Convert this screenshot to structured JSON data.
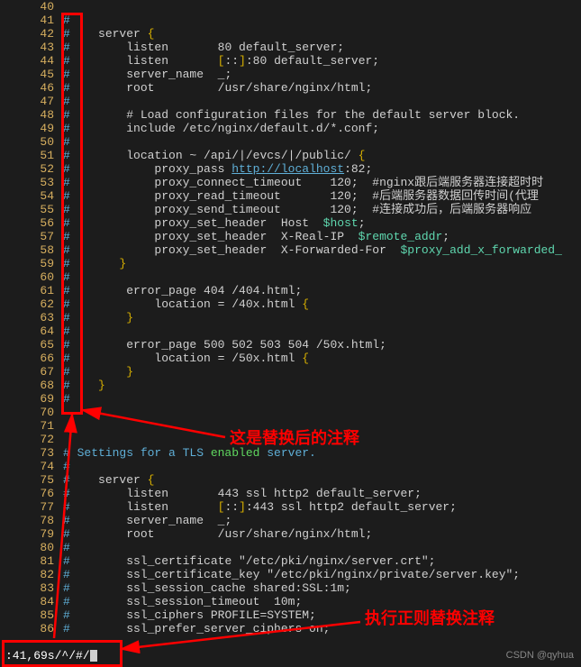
{
  "lines": [
    {
      "n": 40,
      "segs": [
        {
          "t": "",
          "cls": ""
        }
      ]
    },
    {
      "n": 41,
      "segs": [
        {
          "t": "#",
          "cls": "c-comment"
        }
      ]
    },
    {
      "n": 42,
      "segs": [
        {
          "t": "#",
          "cls": "c-comment"
        },
        {
          "t": "    server ",
          "cls": "c-default"
        },
        {
          "t": "{",
          "cls": "c-bracket"
        }
      ]
    },
    {
      "n": 43,
      "segs": [
        {
          "t": "#",
          "cls": "c-comment"
        },
        {
          "t": "        listen       80 default_server;",
          "cls": "c-default"
        }
      ]
    },
    {
      "n": 44,
      "segs": [
        {
          "t": "#",
          "cls": "c-comment"
        },
        {
          "t": "        listen       ",
          "cls": "c-default"
        },
        {
          "t": "[",
          "cls": "c-bracket"
        },
        {
          "t": "::",
          "cls": "c-default"
        },
        {
          "t": "]",
          "cls": "c-bracket"
        },
        {
          "t": ":80 default_server;",
          "cls": "c-default"
        }
      ]
    },
    {
      "n": 45,
      "segs": [
        {
          "t": "#",
          "cls": "c-comment"
        },
        {
          "t": "        server_name  _;",
          "cls": "c-default"
        }
      ]
    },
    {
      "n": 46,
      "segs": [
        {
          "t": "#",
          "cls": "c-comment"
        },
        {
          "t": "        root         /usr/share/nginx/html;",
          "cls": "c-default"
        }
      ]
    },
    {
      "n": 47,
      "segs": [
        {
          "t": "#",
          "cls": "c-comment"
        }
      ]
    },
    {
      "n": 48,
      "segs": [
        {
          "t": "#",
          "cls": "c-comment"
        },
        {
          "t": "        # Load configuration files for the default server block.",
          "cls": "c-default"
        }
      ]
    },
    {
      "n": 49,
      "segs": [
        {
          "t": "#",
          "cls": "c-comment"
        },
        {
          "t": "        include /etc/nginx/default.d/*.conf;",
          "cls": "c-default"
        }
      ]
    },
    {
      "n": 50,
      "segs": [
        {
          "t": "#",
          "cls": "c-comment"
        }
      ]
    },
    {
      "n": 51,
      "segs": [
        {
          "t": "#",
          "cls": "c-comment"
        },
        {
          "t": "        location ~ /api/|/evcs/|/public/ ",
          "cls": "c-default"
        },
        {
          "t": "{",
          "cls": "c-bracket"
        }
      ]
    },
    {
      "n": 52,
      "segs": [
        {
          "t": "#",
          "cls": "c-comment"
        },
        {
          "t": "            proxy_pass ",
          "cls": "c-default"
        },
        {
          "t": "http://localhost",
          "cls": "c-host"
        },
        {
          "t": ":82;",
          "cls": "c-default"
        }
      ]
    },
    {
      "n": 53,
      "segs": [
        {
          "t": "#",
          "cls": "c-comment"
        },
        {
          "t": "            proxy_connect_timeout    120;  #nginx跟后端服务器连接超时时",
          "cls": "c-default"
        }
      ]
    },
    {
      "n": 54,
      "segs": [
        {
          "t": "#",
          "cls": "c-comment"
        },
        {
          "t": "            proxy_read_timeout       120;  #后端服务器数据回传时间(代理",
          "cls": "c-default"
        }
      ]
    },
    {
      "n": 55,
      "segs": [
        {
          "t": "#",
          "cls": "c-comment"
        },
        {
          "t": "            proxy_send_timeout       120;  #连接成功后，后端服务器响应",
          "cls": "c-default"
        }
      ]
    },
    {
      "n": 56,
      "segs": [
        {
          "t": "#",
          "cls": "c-comment"
        },
        {
          "t": "            proxy_set_header  Host  ",
          "cls": "c-default"
        },
        {
          "t": "$host",
          "cls": "c-var"
        },
        {
          "t": ";",
          "cls": "c-default"
        }
      ]
    },
    {
      "n": 57,
      "segs": [
        {
          "t": "#",
          "cls": "c-comment"
        },
        {
          "t": "            proxy_set_header  X-Real-IP  ",
          "cls": "c-default"
        },
        {
          "t": "$remote_addr",
          "cls": "c-var"
        },
        {
          "t": ";",
          "cls": "c-default"
        }
      ]
    },
    {
      "n": 58,
      "segs": [
        {
          "t": "#",
          "cls": "c-comment"
        },
        {
          "t": "            proxy_set_header  X-Forwarded-For  ",
          "cls": "c-default"
        },
        {
          "t": "$proxy_add_x_forwarded_",
          "cls": "c-var"
        }
      ]
    },
    {
      "n": 59,
      "segs": [
        {
          "t": "#",
          "cls": "c-comment"
        },
        {
          "t": "       ",
          "cls": "c-default"
        },
        {
          "t": "}",
          "cls": "c-bracket"
        }
      ]
    },
    {
      "n": 60,
      "segs": [
        {
          "t": "#",
          "cls": "c-comment"
        }
      ]
    },
    {
      "n": 61,
      "segs": [
        {
          "t": "#",
          "cls": "c-comment"
        },
        {
          "t": "        error_page 404 /404.html;",
          "cls": "c-default"
        }
      ]
    },
    {
      "n": 62,
      "segs": [
        {
          "t": "#",
          "cls": "c-comment"
        },
        {
          "t": "            location = /40x.html ",
          "cls": "c-default"
        },
        {
          "t": "{",
          "cls": "c-bracket"
        }
      ]
    },
    {
      "n": 63,
      "segs": [
        {
          "t": "#",
          "cls": "c-comment"
        },
        {
          "t": "        ",
          "cls": "c-default"
        },
        {
          "t": "}",
          "cls": "c-bracket"
        }
      ]
    },
    {
      "n": 64,
      "segs": [
        {
          "t": "#",
          "cls": "c-comment"
        }
      ]
    },
    {
      "n": 65,
      "segs": [
        {
          "t": "#",
          "cls": "c-comment"
        },
        {
          "t": "        error_page 500 502 503 504 /50x.html;",
          "cls": "c-default"
        }
      ]
    },
    {
      "n": 66,
      "segs": [
        {
          "t": "#",
          "cls": "c-comment"
        },
        {
          "t": "            location = /50x.html ",
          "cls": "c-default"
        },
        {
          "t": "{",
          "cls": "c-bracket"
        }
      ]
    },
    {
      "n": 67,
      "segs": [
        {
          "t": "#",
          "cls": "c-comment"
        },
        {
          "t": "        ",
          "cls": "c-default"
        },
        {
          "t": "}",
          "cls": "c-bracket"
        }
      ]
    },
    {
      "n": 68,
      "segs": [
        {
          "t": "#",
          "cls": "c-comment"
        },
        {
          "t": "    ",
          "cls": "c-default"
        },
        {
          "t": "}",
          "cls": "c-bracket"
        }
      ]
    },
    {
      "n": 69,
      "segs": [
        {
          "t": "#",
          "cls": "c-comment"
        }
      ]
    },
    {
      "n": 70,
      "segs": [
        {
          "t": "",
          "cls": ""
        }
      ]
    },
    {
      "n": 71,
      "segs": [
        {
          "t": "",
          "cls": ""
        }
      ]
    },
    {
      "n": 72,
      "segs": [
        {
          "t": "",
          "cls": ""
        }
      ]
    },
    {
      "n": 73,
      "segs": [
        {
          "t": "# Settings for a TLS ",
          "cls": "c-comment"
        },
        {
          "t": "enabled",
          "cls": "c-kw"
        },
        {
          "t": " server.",
          "cls": "c-comment"
        }
      ]
    },
    {
      "n": 74,
      "segs": [
        {
          "t": "#",
          "cls": "c-comment"
        }
      ]
    },
    {
      "n": 75,
      "segs": [
        {
          "t": "#",
          "cls": "c-comment"
        },
        {
          "t": "    server ",
          "cls": "c-default"
        },
        {
          "t": "{",
          "cls": "c-bracket"
        }
      ]
    },
    {
      "n": 76,
      "segs": [
        {
          "t": "#",
          "cls": "c-comment"
        },
        {
          "t": "        listen       443 ssl http2 default_server;",
          "cls": "c-default"
        }
      ]
    },
    {
      "n": 77,
      "segs": [
        {
          "t": "#",
          "cls": "c-comment"
        },
        {
          "t": "        listen       ",
          "cls": "c-default"
        },
        {
          "t": "[",
          "cls": "c-bracket"
        },
        {
          "t": "::",
          "cls": "c-default"
        },
        {
          "t": "]",
          "cls": "c-bracket"
        },
        {
          "t": ":443 ssl http2 default_server;",
          "cls": "c-default"
        }
      ]
    },
    {
      "n": 78,
      "segs": [
        {
          "t": "#",
          "cls": "c-comment"
        },
        {
          "t": "        server_name  _;",
          "cls": "c-default"
        }
      ]
    },
    {
      "n": 79,
      "segs": [
        {
          "t": "#",
          "cls": "c-comment"
        },
        {
          "t": "        root         /usr/share/nginx/html;",
          "cls": "c-default"
        }
      ]
    },
    {
      "n": 80,
      "segs": [
        {
          "t": "#",
          "cls": "c-comment"
        }
      ]
    },
    {
      "n": 81,
      "segs": [
        {
          "t": "#",
          "cls": "c-comment"
        },
        {
          "t": "        ssl_certificate \"/etc/pki/nginx/server.crt\";",
          "cls": "c-default"
        }
      ]
    },
    {
      "n": 82,
      "segs": [
        {
          "t": "#",
          "cls": "c-comment"
        },
        {
          "t": "        ssl_certificate_key \"/etc/pki/nginx/private/server.key\";",
          "cls": "c-default"
        }
      ]
    },
    {
      "n": 83,
      "segs": [
        {
          "t": "#",
          "cls": "c-comment"
        },
        {
          "t": "        ssl_session_cache shared:SSL:1m;",
          "cls": "c-default"
        }
      ]
    },
    {
      "n": 84,
      "segs": [
        {
          "t": "#",
          "cls": "c-comment"
        },
        {
          "t": "        ssl_session_timeout  10m;",
          "cls": "c-default"
        }
      ]
    },
    {
      "n": 85,
      "segs": [
        {
          "t": "#",
          "cls": "c-comment"
        },
        {
          "t": "        ssl_ciphers PROFILE=SYSTEM;",
          "cls": "c-default"
        }
      ]
    },
    {
      "n": 86,
      "segs": [
        {
          "t": "#",
          "cls": "c-comment"
        },
        {
          "t": "        ssl_prefer_server_ciphers on;",
          "cls": "c-default"
        }
      ]
    }
  ],
  "statusbar": ":41,69s/^/#/",
  "annotations": {
    "after_replace": "这是替换后的注释",
    "regex_replace": "执行正则替换注释"
  },
  "watermark": "CSDN @qyhua"
}
